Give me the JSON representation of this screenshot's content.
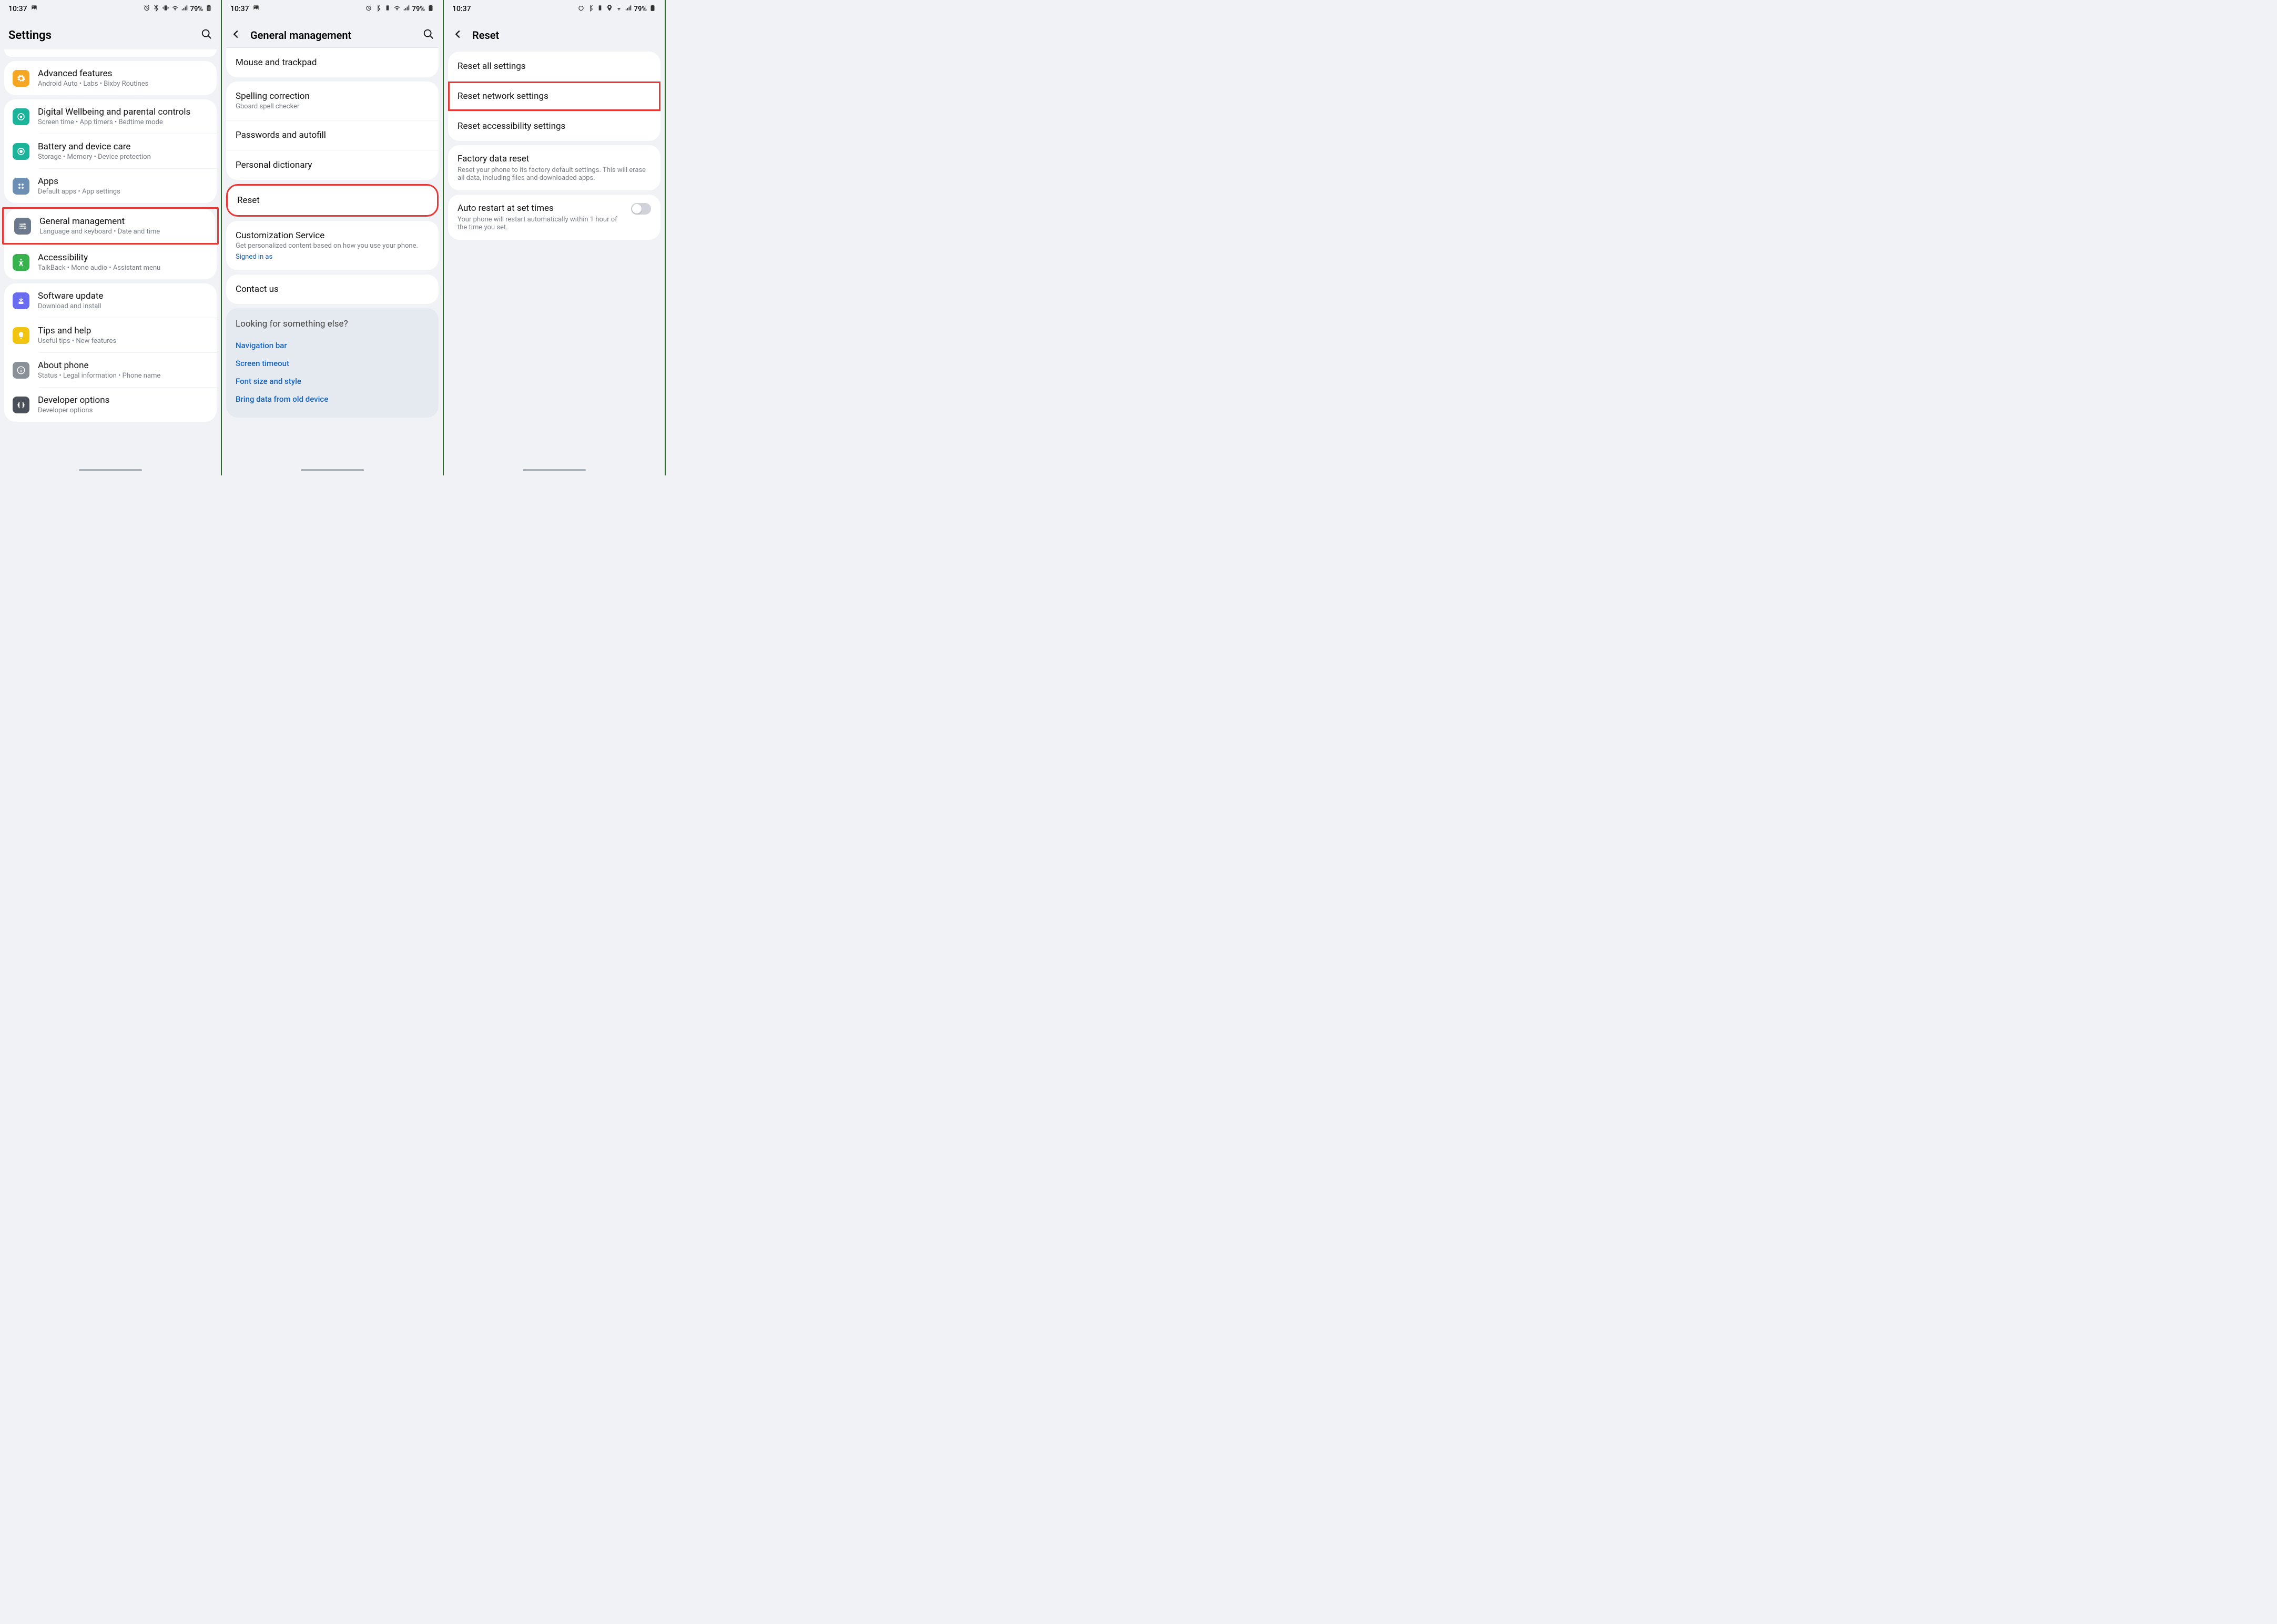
{
  "status": {
    "time": "10:37",
    "battery": "79%"
  },
  "panel1": {
    "title": "Settings",
    "groups": [
      {
        "type": "peek"
      },
      {
        "rows": [
          {
            "icon": "gear",
            "color": "ic-orange",
            "title": "Advanced features",
            "sub": "Android Auto  •  Labs  •  Bixby Routines"
          }
        ]
      },
      {
        "rows": [
          {
            "icon": "wellbeing",
            "color": "ic-teal",
            "title": "Digital Wellbeing and parental controls",
            "sub": "Screen time  •  App timers  •  Bedtime mode"
          },
          {
            "icon": "battery",
            "color": "ic-teal",
            "title": "Battery and device care",
            "sub": "Storage  •  Memory  •  Device protection"
          },
          {
            "icon": "apps",
            "color": "ic-bluegrey",
            "title": "Apps",
            "sub": "Default apps  •  App settings"
          }
        ]
      },
      {
        "rows": [
          {
            "icon": "sliders",
            "color": "ic-slate",
            "title": "General management",
            "sub": "Language and keyboard  •  Date and time",
            "highlight": true
          },
          {
            "icon": "accessibility",
            "color": "ic-green",
            "title": "Accessibility",
            "sub": "TalkBack  •  Mono audio  •  Assistant menu"
          }
        ]
      },
      {
        "rows": [
          {
            "icon": "update",
            "color": "ic-violet",
            "title": "Software update",
            "sub": "Download and install"
          },
          {
            "icon": "bulb",
            "color": "ic-yellow",
            "title": "Tips and help",
            "sub": "Useful tips  •  New features"
          },
          {
            "icon": "info",
            "color": "ic-grey",
            "title": "About phone",
            "sub": "Status  •  Legal information  •  Phone name"
          },
          {
            "icon": "dev",
            "color": "ic-dark",
            "title": "Developer options",
            "sub": "Developer options"
          }
        ]
      }
    ]
  },
  "panel2": {
    "title": "General management",
    "groups": [
      {
        "rows": [
          {
            "title": "Mouse and trackpad"
          }
        ]
      },
      {
        "rows": [
          {
            "title": "Spelling correction",
            "sub": "Gboard spell checker"
          },
          {
            "title": "Passwords and autofill"
          },
          {
            "title": "Personal dictionary"
          }
        ]
      },
      {
        "rows": [
          {
            "title": "Reset",
            "highlight": true
          }
        ]
      },
      {
        "rows": [
          {
            "title": "Customization Service",
            "sub": "Get personalized content based on how you use your phone.",
            "signin": "Signed in as"
          }
        ]
      },
      {
        "rows": [
          {
            "title": "Contact us"
          }
        ]
      }
    ],
    "lookfor": {
      "title": "Looking for something else?",
      "links": [
        "Navigation bar",
        "Screen timeout",
        "Font size and style",
        "Bring data from old device"
      ]
    }
  },
  "panel3": {
    "title": "Reset",
    "groups": [
      {
        "rows": [
          {
            "title": "Reset all settings"
          },
          {
            "title": "Reset network settings",
            "highlight": true
          },
          {
            "title": "Reset accessibility settings"
          }
        ]
      },
      {
        "rows": [
          {
            "title": "Factory data reset",
            "sub": "Reset your phone to its factory default settings. This will erase all data, including files and downloaded apps."
          }
        ]
      },
      {
        "rows": [
          {
            "title": "Auto restart at set times",
            "sub": "Your phone will restart automatically within 1 hour of the time you set.",
            "toggle": true
          }
        ]
      }
    ]
  }
}
